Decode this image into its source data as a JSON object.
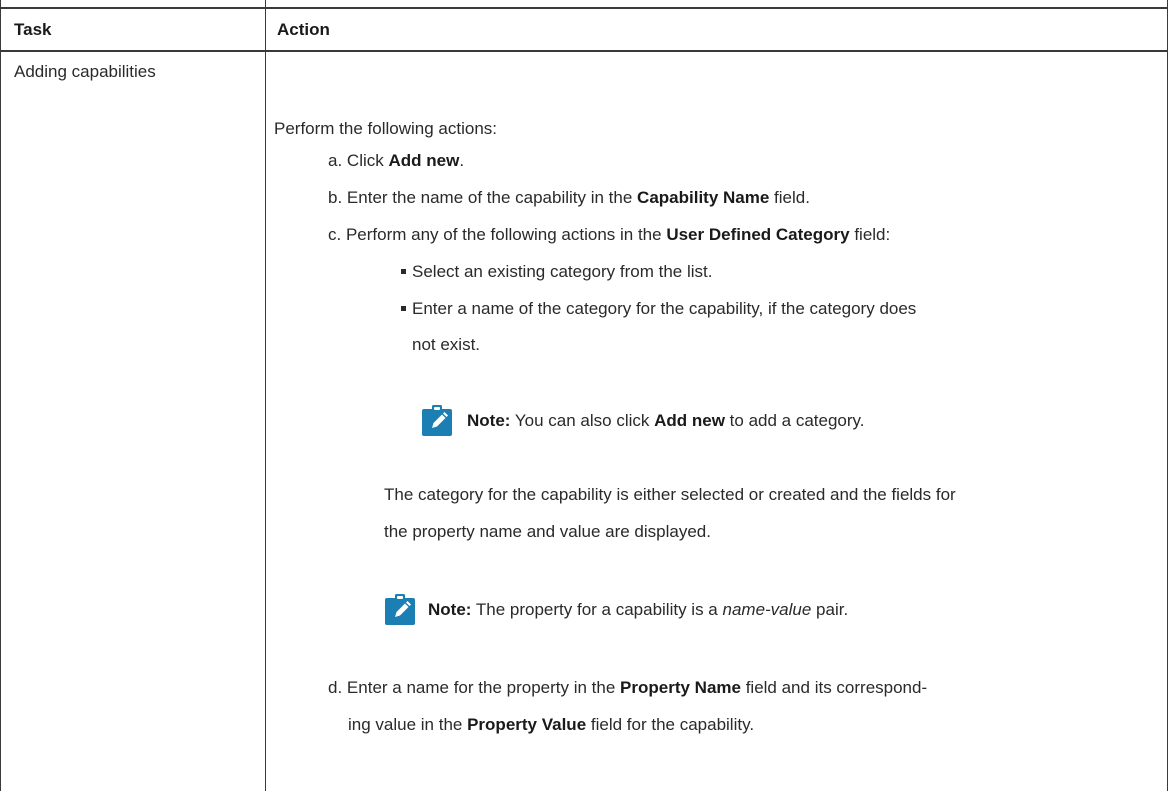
{
  "table": {
    "headers": [
      "Task",
      "Action"
    ],
    "task_label": "Adding capabilities",
    "intro": "Perform the following actions:",
    "steps": {
      "a": {
        "marker": "a.",
        "pre": "Click ",
        "bold": "Add new",
        "post": "."
      },
      "b": {
        "marker": "b.",
        "pre": "Enter the name of the capability in the ",
        "bold": "Capability Name",
        "post": " field."
      },
      "c": {
        "marker": "c.",
        "pre": "Perform any of the following actions in the ",
        "bold": "User Defined Category",
        "post": " field:"
      },
      "d": {
        "marker": "d.",
        "line1_pre": "Enter a name for the property in the ",
        "line1_bold1": "Property Name",
        "line1_post": " field and its correspond-",
        "line2_pre": "ing value in the ",
        "line2_bold": "Property Value",
        "line2_post": " field for the capability."
      }
    },
    "sub_bullets": {
      "one": "Select an existing category from the list.",
      "two_line1": "Enter a name of the category for the capability, if the category does",
      "two_line2": "not exist."
    },
    "note1": {
      "label": "Note:",
      "pre": " You can also click ",
      "bold": "Add new",
      "post": " to add a category."
    },
    "result": {
      "line1": "The category for the capability is either selected or created and the fields for",
      "line2": "the property name and value are displayed."
    },
    "note2": {
      "label": "Note:",
      "pre": " The property for a capability is a ",
      "italic": "name-value",
      "post": " pair."
    }
  },
  "colors": {
    "note_icon": "#1b7fb3",
    "border": "#3a3a3a"
  },
  "icons": [
    "note-icon"
  ]
}
